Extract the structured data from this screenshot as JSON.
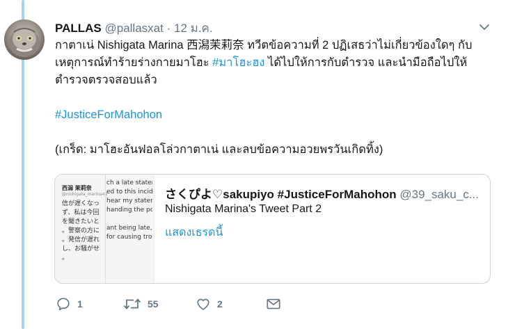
{
  "tweet": {
    "display_name": "PALLAS",
    "handle": "@pallasxat",
    "separator": "·",
    "time": "12 ม.ค.",
    "line1": "กาตาเน่ Nishigata Marina 西潟茉莉奈 ทวีตข้อความที่ 2 ปฏิเสธว่าไม่เกี่ยวข้องใดๆ กับ",
    "line2_pre": "เหตุการณ์ทำร้ายร่างกายมาโฮะ ",
    "line2_tag": "#มาโฮะฮง",
    "line2_post": " ได้ไปให้การกับตำรวจ และนำมือถือไปให้",
    "line3": "ตำรวจตรวจสอบแล้ว",
    "hashtag_line": "#JusticeForMahohon",
    "trivia": "(เกร็ด: มาโฮะอันฟอลโล่วกาตาเน่ และลบข้อความอวยพรวันเกิดทิ้ง)"
  },
  "quote": {
    "display_name": "さくぴよ♡sakupiyo #JusticeForMahohon",
    "handle": "@39_saku_c...",
    "text": "Nishigata Marina's Tweet Part 2",
    "show_thread": "แสดงเธรดนี้",
    "thumbnail": {
      "name": "西潟 茉莉奈",
      "sub": "@nishigata_marina48",
      "jp_lines": [
        "信が遅くなっ",
        "ず、私は今回",
        "を聞きたいと",
        "。警察の方に",
        "。発信が遅れ",
        "し、お騒がせ",
        "。"
      ],
      "en_lines": [
        "ch a late statem",
        "ed to this incide",
        "hear my statem",
        "handing the poli",
        "",
        "ant being late, I",
        "for causing troul"
      ]
    }
  },
  "actions": {
    "reply_count": "1",
    "retweet_count": "55",
    "like_count": "2"
  },
  "colors": {
    "link": "#1b95e0",
    "muted": "#657786",
    "thread_line": "#a7d3f2"
  }
}
